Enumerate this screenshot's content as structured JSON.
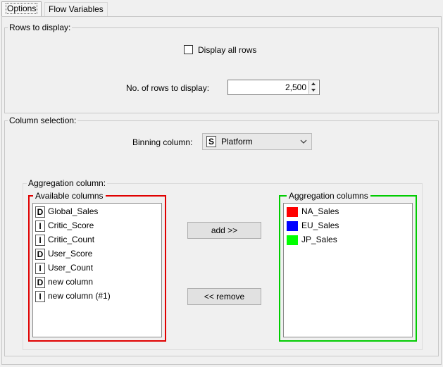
{
  "tabs": [
    {
      "label": "Options"
    },
    {
      "label": "Flow Variables"
    }
  ],
  "rows_group": {
    "title": "Rows to display:",
    "display_all_label": "Display all rows",
    "display_all_checked": false,
    "num_rows_label": "No. of rows to display:",
    "num_rows_value": "2,500"
  },
  "column_group": {
    "title": "Column selection:",
    "binning_label": "Binning column:",
    "binning_type": "S",
    "binning_value": "Platform"
  },
  "aggregation": {
    "title": "Aggregation column:",
    "available_title": "Available columns",
    "selected_title": "Aggregation columns",
    "available": [
      {
        "type": "D",
        "name": "Global_Sales"
      },
      {
        "type": "I",
        "name": "Critic_Score"
      },
      {
        "type": "I",
        "name": "Critic_Count"
      },
      {
        "type": "D",
        "name": "User_Score"
      },
      {
        "type": "I",
        "name": "User_Count"
      },
      {
        "type": "D",
        "name": "new column"
      },
      {
        "type": "I",
        "name": "new column (#1)"
      }
    ],
    "selected": [
      {
        "color": "#ff0000",
        "name": "NA_Sales"
      },
      {
        "color": "#0000ff",
        "name": "EU_Sales"
      },
      {
        "color": "#00ff00",
        "name": "JP_Sales"
      }
    ],
    "add_label": "add >>",
    "remove_label": "<< remove"
  },
  "colors": {
    "available_frame": "#e00000",
    "selected_frame": "#00cc00"
  }
}
